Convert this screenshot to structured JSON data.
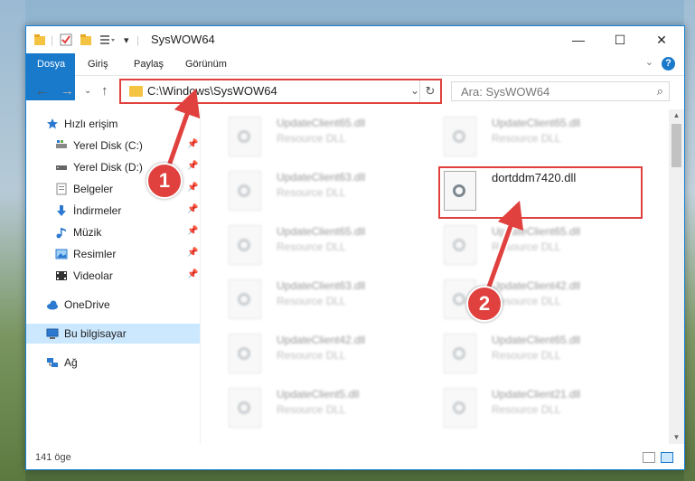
{
  "window": {
    "title": "SysWOW64",
    "controls": {
      "minimize": "—",
      "maximize": "☐",
      "close": "✕"
    }
  },
  "ribbon": {
    "tabs": [
      "Dosya",
      "Giriş",
      "Paylaş",
      "Görünüm"
    ],
    "help": "?"
  },
  "address": {
    "path": "C:\\Windows\\SysWOW64",
    "search_placeholder": "Ara: SysWOW64"
  },
  "sidebar": {
    "items": [
      {
        "label": "Hızlı erişim",
        "icon": "star-icon"
      },
      {
        "label": "Yerel Disk (C:)",
        "icon": "drive-icon",
        "pinned": true
      },
      {
        "label": "Yerel Disk (D:)",
        "icon": "drive-icon",
        "pinned": true
      },
      {
        "label": "Belgeler",
        "icon": "documents-icon",
        "pinned": true
      },
      {
        "label": "İndirmeler",
        "icon": "download-icon",
        "pinned": true
      },
      {
        "label": "Müzik",
        "icon": "music-icon",
        "pinned": true
      },
      {
        "label": "Resimler",
        "icon": "pictures-icon",
        "pinned": true
      },
      {
        "label": "Videolar",
        "icon": "videos-icon",
        "pinned": true
      },
      {
        "label": "OneDrive",
        "icon": "cloud-icon"
      },
      {
        "label": "Bu bilgisayar",
        "icon": "computer-icon",
        "selected": true
      },
      {
        "label": "Ağ",
        "icon": "network-icon"
      }
    ]
  },
  "files": {
    "type_label": "Resource DLL",
    "left_column": [
      "UpdateClient65.dll",
      "UpdateClient63.dll",
      "UpdateClient65.dll",
      "UpdateClient63.dll",
      "UpdateClient42.dll",
      "UpdateClient5.dll"
    ],
    "right_column": [
      "UpdateClient65.dll",
      "dortddm7420.dll",
      "UpdateClient65.dll",
      "UpdateClient42.dll",
      "UpdateClient65.dll",
      "UpdateClient21.dll"
    ],
    "highlighted": "dortddm7420.dll"
  },
  "status": {
    "count": "141 öge"
  },
  "annotations": {
    "marker1": "1",
    "marker2": "2"
  },
  "colors": {
    "accent": "#1979ca",
    "highlight": "#e0413e",
    "selected": "#cce8ff"
  }
}
